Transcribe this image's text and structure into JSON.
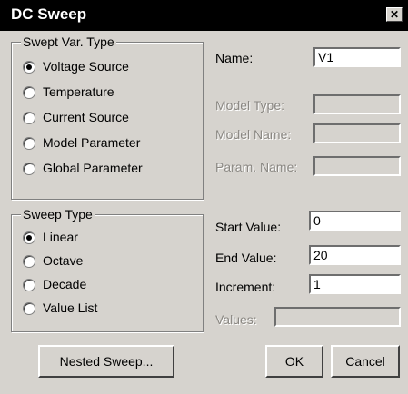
{
  "window": {
    "title": "DC Sweep",
    "close_symbol": "✕"
  },
  "swept_var": {
    "title": "Swept Var. Type",
    "options": [
      {
        "label": "Voltage Source",
        "checked": true
      },
      {
        "label": "Temperature",
        "checked": false
      },
      {
        "label": "Current Source",
        "checked": false
      },
      {
        "label": "Model Parameter",
        "checked": false
      },
      {
        "label": "Global Parameter",
        "checked": false
      }
    ]
  },
  "sweep_type": {
    "title": "Sweep Type",
    "options": [
      {
        "label": "Linear",
        "checked": true
      },
      {
        "label": "Octave",
        "checked": false
      },
      {
        "label": "Decade",
        "checked": false
      },
      {
        "label": "Value List",
        "checked": false
      }
    ]
  },
  "fields": {
    "name": {
      "label": "Name:",
      "value": "V1"
    },
    "model_type": {
      "label": "Model Type:",
      "value": ""
    },
    "model_name": {
      "label": "Model Name:",
      "value": ""
    },
    "param_name": {
      "label": "Param. Name:",
      "value": ""
    },
    "start_value": {
      "label": "Start Value:",
      "value": "0"
    },
    "end_value": {
      "label": "End Value:",
      "value": "20"
    },
    "increment": {
      "label": "Increment:",
      "value": "1"
    },
    "values": {
      "label": "Values:",
      "value": ""
    }
  },
  "buttons": {
    "nested_sweep": "Nested Sweep...",
    "ok": "OK",
    "cancel": "Cancel"
  }
}
